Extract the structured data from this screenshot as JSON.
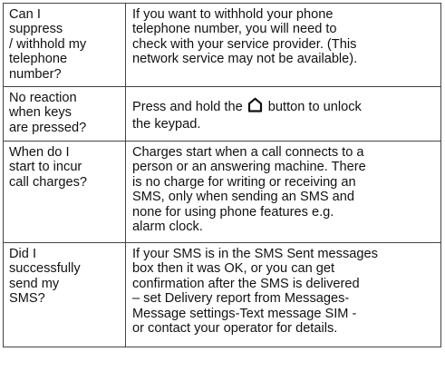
{
  "faq": [
    {
      "question": "Can I\nsuppress\n/ withhold my\ntelephone\nnumber?",
      "answer": "If you want to withhold your phone\ntelephone number, you will need to\ncheck with your service provider. (This\nnetwork service may not be available)."
    },
    {
      "question": "No reaction\nwhen keys\nare pressed?",
      "answer_before_icon": "Press and hold the ",
      "icon": "house-icon",
      "answer_after_icon": " button to unlock\nthe keypad."
    },
    {
      "question": "When do I\nstart to incur\ncall charges?",
      "answer": "Charges start when a call connects to a\nperson or an answering machine. There\nis no charge for writing or receiving an\nSMS, only when sending an SMS and\nnone for using phone features e.g.\nalarm clock."
    },
    {
      "question": "Did I\nsuccessfully\nsend my\nSMS?",
      "answer": "If your SMS is in the SMS Sent messages\nbox then it  was OK, or you can get\nconfirmation after the SMS is delivered\n– set Delivery report from Messages-\nMessage settings-Text message SIM -\nor contact your operator for details."
    }
  ]
}
